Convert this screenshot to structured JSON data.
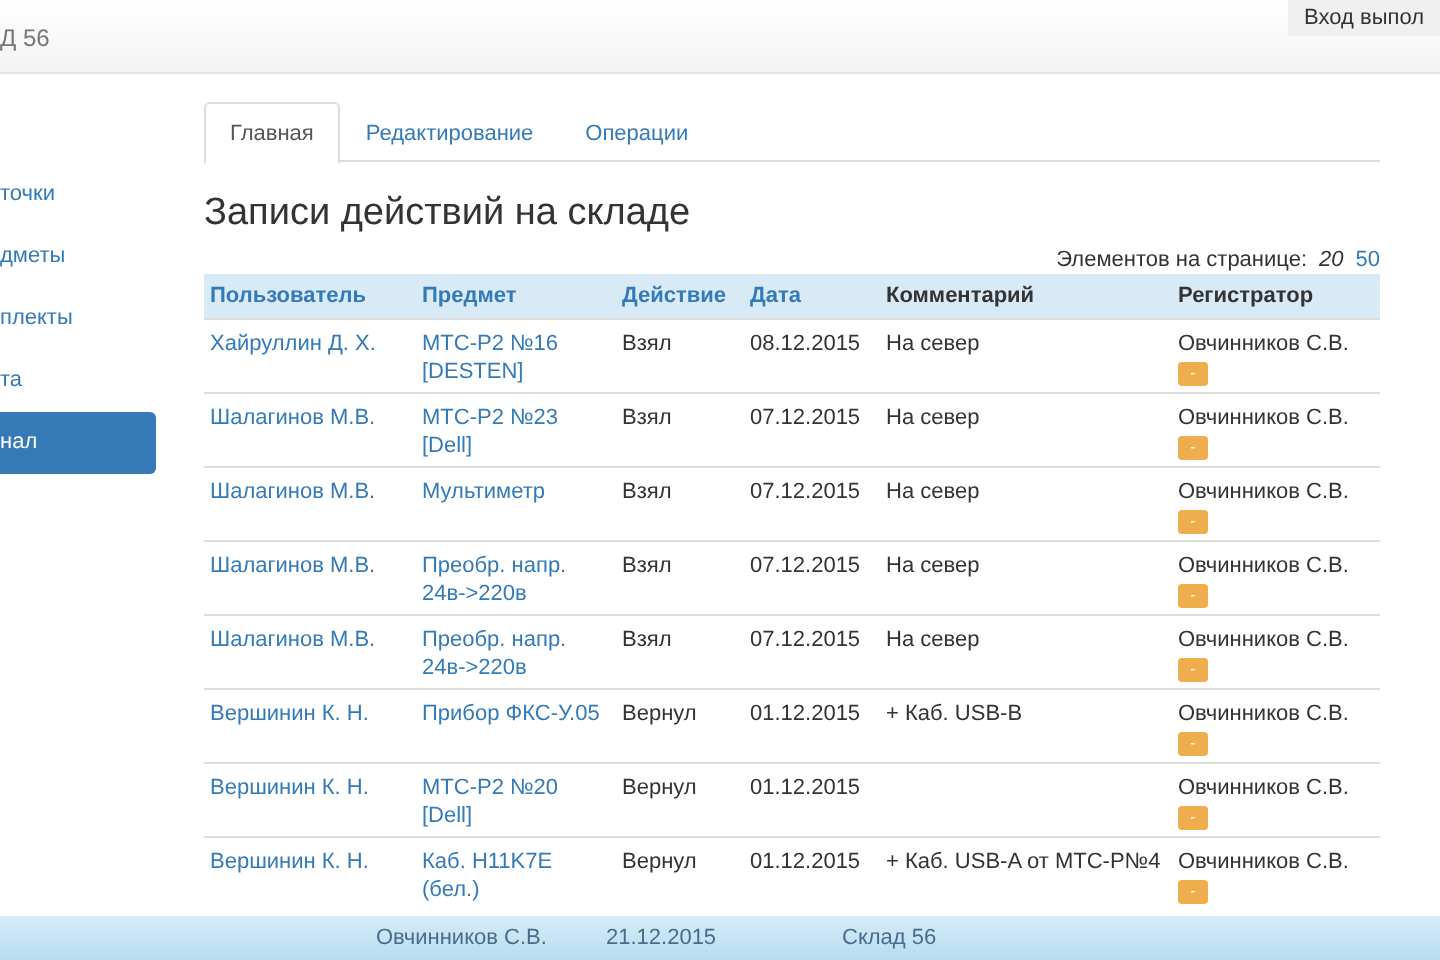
{
  "navbar": {
    "brand": "Д 56",
    "login_button": "Вход выпол"
  },
  "sidebar": {
    "items": [
      {
        "label": "точки",
        "selected": false
      },
      {
        "label": "дметы",
        "selected": false
      },
      {
        "label": "плекты",
        "selected": false
      },
      {
        "label": "та",
        "selected": false
      },
      {
        "label": "нал",
        "selected": true
      }
    ]
  },
  "tabs": [
    {
      "label": "Главная",
      "selected": true
    },
    {
      "label": "Редактирование",
      "selected": false
    },
    {
      "label": "Операции",
      "selected": false
    }
  ],
  "heading": "Записи действий на складе",
  "page_size": {
    "label": "Элементов на странице:",
    "options": [
      {
        "label": "20",
        "selected": true
      },
      {
        "label": "50",
        "selected": false
      }
    ]
  },
  "table": {
    "columns": [
      {
        "label": "Пользователь",
        "sortable": true
      },
      {
        "label": "Предмет",
        "sortable": true
      },
      {
        "label": "Действие",
        "sortable": true
      },
      {
        "label": "Дата",
        "sortable": true
      },
      {
        "label": "Комментарий",
        "sortable": false
      },
      {
        "label": "Регистратор",
        "sortable": false
      }
    ],
    "rows": [
      {
        "user": "Хайруллин Д. Х.",
        "item": "МТС-Р2 №16 [DESTEN]",
        "action": "Взял",
        "date": "08.12.2015",
        "comment": "На север",
        "registrar": "Овчинников С.В.",
        "button": "-"
      },
      {
        "user": "Шалагинов М.В.",
        "item": "МТС-Р2 №23 [Dell]",
        "action": "Взял",
        "date": "07.12.2015",
        "comment": "На север",
        "registrar": "Овчинников С.В.",
        "button": "-"
      },
      {
        "user": "Шалагинов М.В.",
        "item": "Мультиметр",
        "action": "Взял",
        "date": "07.12.2015",
        "comment": "На север",
        "registrar": "Овчинников С.В.",
        "button": "-"
      },
      {
        "user": "Шалагинов М.В.",
        "item": "Преобр. напр. 24в->220в",
        "action": "Взял",
        "date": "07.12.2015",
        "comment": "На север",
        "registrar": "Овчинников С.В.",
        "button": "-"
      },
      {
        "user": "Шалагинов М.В.",
        "item": "Преобр. напр. 24в->220в",
        "action": "Взял",
        "date": "07.12.2015",
        "comment": "На север",
        "registrar": "Овчинников С.В.",
        "button": "-"
      },
      {
        "user": "Вершинин К. Н.",
        "item": "Прибор ФКС-У.05",
        "action": "Вернул",
        "date": "01.12.2015",
        "comment": "+ Каб. USB-B",
        "registrar": "Овчинников С.В.",
        "button": "-"
      },
      {
        "user": "Вершинин К. Н.",
        "item": "МТС-Р2 №20 [Dell]",
        "action": "Вернул",
        "date": "01.12.2015",
        "comment": "",
        "registrar": "Овчинников С.В.",
        "button": "-"
      },
      {
        "user": "Вершинин К. Н.",
        "item": "Каб. H11K7E (бел.)",
        "action": "Вернул",
        "date": "01.12.2015",
        "comment": "+ Каб. USB-A от МТС-Р№4",
        "registrar": "Овчинников С.В.",
        "button": "-"
      }
    ]
  },
  "footer": {
    "user": "Овчинников С.В.",
    "date": "21.12.2015",
    "warehouse": "Склад 56"
  }
}
